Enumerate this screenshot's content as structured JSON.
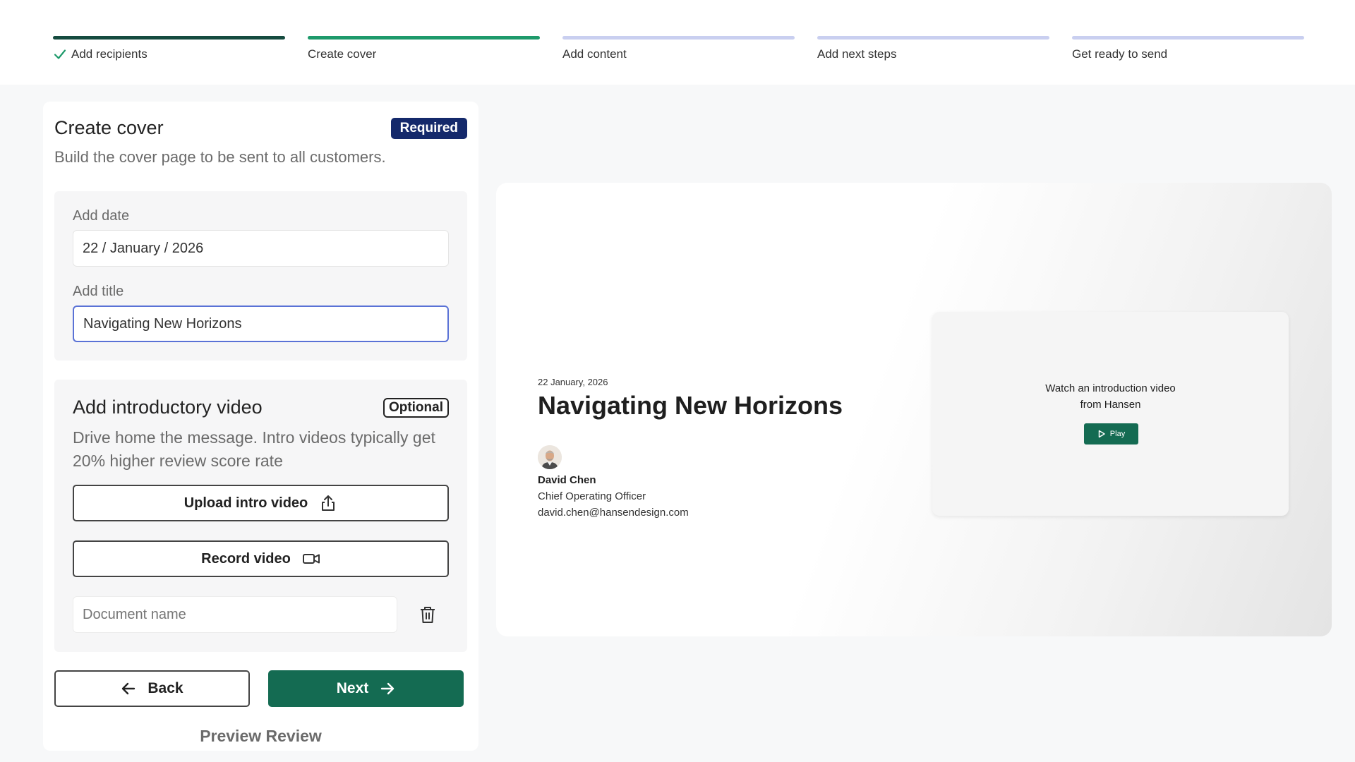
{
  "stepper": {
    "steps": [
      {
        "label": "Add recipients",
        "state": "done"
      },
      {
        "label": "Create cover",
        "state": "current"
      },
      {
        "label": "Add content",
        "state": "upcoming"
      },
      {
        "label": "Add next steps",
        "state": "upcoming"
      },
      {
        "label": "Get ready to send",
        "state": "upcoming"
      }
    ]
  },
  "form": {
    "title": "Create cover",
    "required_badge": "Required",
    "description": "Build the cover page to be sent to all customers.",
    "date": {
      "label": "Add date",
      "value": "22 / January / 2026"
    },
    "title_field": {
      "label": "Add title",
      "value": "Navigating New Horizons"
    },
    "video": {
      "title": "Add introductory video",
      "optional_badge": "Optional",
      "description": "Drive home the message. Intro videos typically get 20% higher review score rate",
      "upload_label": "Upload intro video",
      "record_label": "Record video",
      "document_name_placeholder": "Document name"
    },
    "back_label": "Back",
    "next_label": "Next",
    "preview_link": "Preview Review"
  },
  "preview": {
    "date": "22 January, 2026",
    "title": "Navigating New Horizons",
    "author": {
      "name": "David Chen",
      "role": "Chief Operating Officer",
      "email": "david.chen@hansendesign.com"
    },
    "video_card": {
      "caption_line1": "Watch an introduction video",
      "caption_line2": "from Hansen",
      "play_label": "Play"
    }
  },
  "colors": {
    "done_bar": "#154b3f",
    "current_bar": "#1e9a6b",
    "upcoming_bar": "#c9cff0",
    "primary_button": "#146b52",
    "required_badge": "#14296b",
    "focus_border": "#5a72d6"
  },
  "icons": {
    "step_done": "check-icon",
    "upload": "upload-icon",
    "record": "video-camera-icon",
    "delete": "trash-icon",
    "back": "arrow-left-icon",
    "next": "arrow-right-icon",
    "play": "play-icon"
  }
}
